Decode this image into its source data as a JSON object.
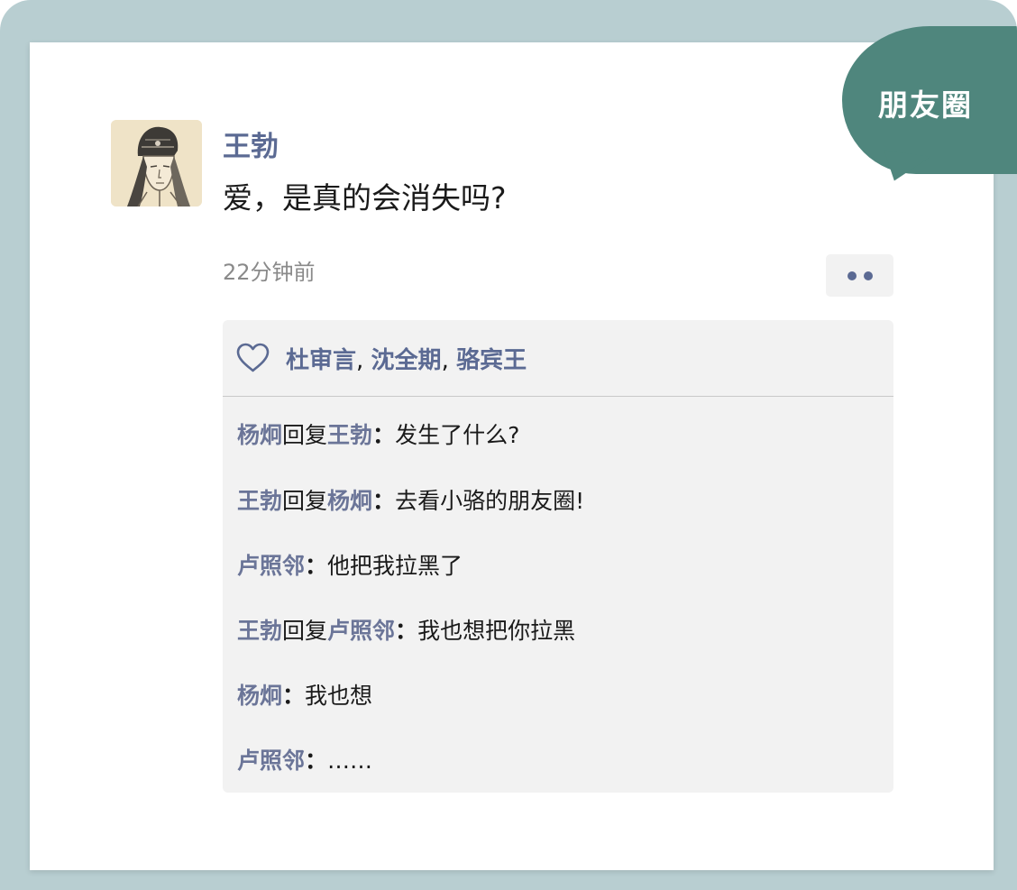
{
  "badge": {
    "label": "朋友圈"
  },
  "post": {
    "author": "王勃",
    "text": "爱，是真的会消失吗?",
    "timestamp": "22分钟前",
    "more_icon": "ellipsis-icon"
  },
  "likes": {
    "icon": "heart-icon",
    "names": [
      "杜审言",
      "沈全期",
      "骆宾王"
    ],
    "separator": ","
  },
  "comments": [
    {
      "from": "杨炯",
      "reply_word": "回复",
      "to": "王勃",
      "colon": "：",
      "text": "发生了什么?"
    },
    {
      "from": "王勃",
      "reply_word": "回复",
      "to": "杨炯",
      "colon": "：",
      "text": "去看小骆的朋友圈!"
    },
    {
      "from": "卢照邻",
      "reply_word": "",
      "to": "",
      "colon": "：",
      "text": "他把我拉黑了"
    },
    {
      "from": "王勃",
      "reply_word": "回复",
      "to": "卢照邻",
      "colon": "：",
      "text": "我也想把你拉黑"
    },
    {
      "from": "杨炯",
      "reply_word": "",
      "to": "",
      "colon": "：",
      "text": "我也想"
    },
    {
      "from": "卢照邻",
      "reply_word": "",
      "to": "",
      "colon": "：",
      "text": "……"
    }
  ],
  "colors": {
    "frame": "#b8ced1",
    "badge": "#4f867d",
    "name_link": "#5b6a93",
    "panel": "#f2f2f2"
  }
}
